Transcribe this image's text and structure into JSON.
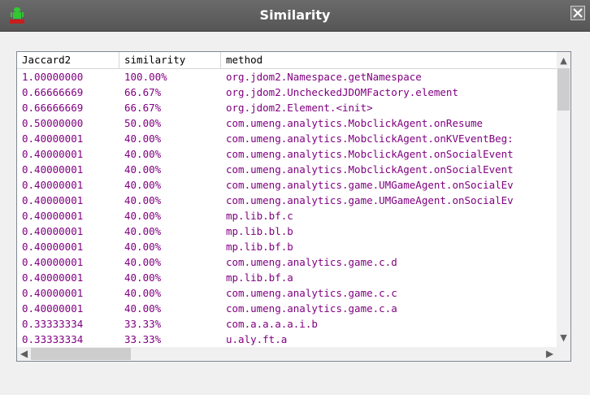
{
  "window": {
    "title": "Similarity",
    "icon": "android-app-icon",
    "close_icon": "close-icon"
  },
  "table": {
    "columns": [
      "Jaccard2",
      "similarity",
      "method"
    ],
    "rows": [
      [
        "1.00000000",
        "100.00%",
        "org.jdom2.Namespace.getNamespace"
      ],
      [
        "0.66666669",
        "66.67%",
        "org.jdom2.UncheckedJDOMFactory.element"
      ],
      [
        "0.66666669",
        "66.67%",
        "org.jdom2.Element.<init>"
      ],
      [
        "0.50000000",
        "50.00%",
        "com.umeng.analytics.MobclickAgent.onResume"
      ],
      [
        "0.40000001",
        "40.00%",
        "com.umeng.analytics.MobclickAgent.onKVEventBeg:"
      ],
      [
        "0.40000001",
        "40.00%",
        "com.umeng.analytics.MobclickAgent.onSocialEvent"
      ],
      [
        "0.40000001",
        "40.00%",
        "com.umeng.analytics.MobclickAgent.onSocialEvent"
      ],
      [
        "0.40000001",
        "40.00%",
        "com.umeng.analytics.game.UMGameAgent.onSocialEv"
      ],
      [
        "0.40000001",
        "40.00%",
        "com.umeng.analytics.game.UMGameAgent.onSocialEv"
      ],
      [
        "0.40000001",
        "40.00%",
        "mp.lib.bf.c"
      ],
      [
        "0.40000001",
        "40.00%",
        "mp.lib.bl.b"
      ],
      [
        "0.40000001",
        "40.00%",
        "mp.lib.bf.b"
      ],
      [
        "0.40000001",
        "40.00%",
        "com.umeng.analytics.game.c.d"
      ],
      [
        "0.40000001",
        "40.00%",
        "mp.lib.bf.a"
      ],
      [
        "0.40000001",
        "40.00%",
        "com.umeng.analytics.game.c.c"
      ],
      [
        "0.40000001",
        "40.00%",
        "com.umeng.analytics.game.c.a"
      ],
      [
        "0.33333334",
        "33.33%",
        "com.a.a.a.a.i.b"
      ],
      [
        "0.33333334",
        "33.33%",
        "u.aly.ft.a"
      ]
    ]
  },
  "colors": {
    "title_bar": "#5e5e5e",
    "row_text": "#800080",
    "background": "#f0f0f0"
  }
}
